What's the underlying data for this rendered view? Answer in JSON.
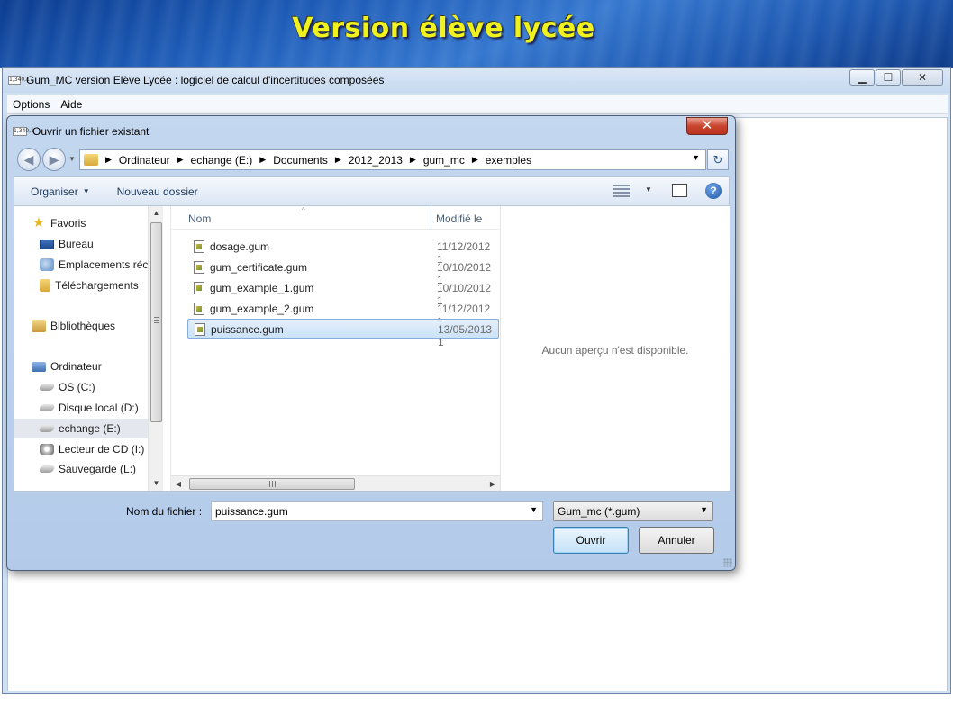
{
  "slide": {
    "title": "Version élève lycée"
  },
  "app": {
    "icon_text": "1,340,1",
    "title": "Gum_MC version Elève Lycée : logiciel de calcul d'incertitudes composées",
    "window_buttons": {
      "minimize": "▁",
      "maximize": "☐",
      "close": "✕"
    },
    "menu": [
      "Options",
      "Aide"
    ]
  },
  "dialog": {
    "icon_text": "1,340,1",
    "title": "Ouvrir un fichier existant",
    "close_glyph": "✕",
    "breadcrumbs": [
      "Ordinateur",
      "echange (E:)",
      "Documents",
      "2012_2013",
      "gum_mc",
      "exemples"
    ],
    "toolbar": {
      "organise_label": "Organiser",
      "new_folder_label": "Nouveau dossier"
    },
    "nav_items": [
      {
        "label": "Favoris",
        "icon": "star-icon"
      },
      {
        "label": "Bureau",
        "icon": "desktop-icon"
      },
      {
        "label": "Emplacements récents",
        "icon": "recent-places-icon"
      },
      {
        "label": "Téléchargements",
        "icon": "downloads-folder-icon"
      },
      {
        "label": "Bibliothèques",
        "icon": "libraries-icon"
      },
      {
        "label": "Ordinateur",
        "icon": "computer-icon"
      },
      {
        "label": "OS (C:)",
        "icon": "os-drive-icon"
      },
      {
        "label": "Disque local (D:)",
        "icon": "drive-icon"
      },
      {
        "label": "echange (E:)",
        "icon": "drive-icon",
        "selected": true
      },
      {
        "label": "Lecteur de CD (I:)",
        "icon": "cd-drive-icon"
      },
      {
        "label": "Sauvegarde (L:)",
        "icon": "drive-icon"
      }
    ],
    "columns": {
      "name": "Nom",
      "modified": "Modifié le"
    },
    "files": [
      {
        "name": "dosage.gum",
        "modified": "11/12/2012 1"
      },
      {
        "name": "gum_certificate.gum",
        "modified": "10/10/2012 1"
      },
      {
        "name": "gum_example_1.gum",
        "modified": "10/10/2012 1"
      },
      {
        "name": "gum_example_2.gum",
        "modified": "11/12/2012 1"
      },
      {
        "name": "puissance.gum",
        "modified": "13/05/2013 1",
        "selected": true
      }
    ],
    "preview_text": "Aucun aperçu n'est disponible.",
    "filename_label": "Nom du fichier :",
    "filename_value": "puissance.gum",
    "filter_value": "Gum_mc (*.gum)",
    "open_label": "Ouvrir",
    "cancel_label": "Annuler"
  }
}
